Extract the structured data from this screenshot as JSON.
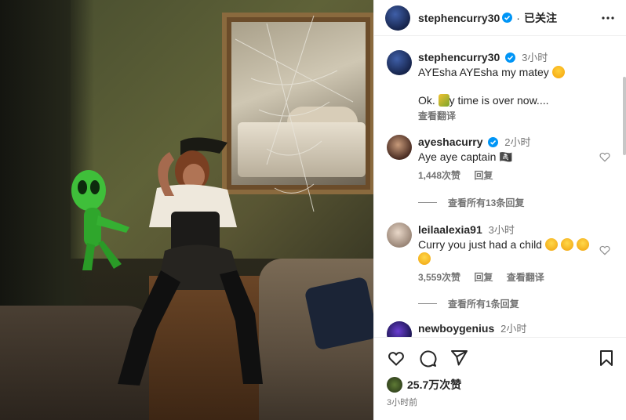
{
  "header": {
    "username": "stephencurry30",
    "follow_label": "已关注",
    "separator": "·"
  },
  "caption": {
    "username": "stephencurry30",
    "time": "3小时",
    "line1": "AYEsha AYEsha my matey",
    "line2": "Ok.",
    "line2_rest": "y time is over now....",
    "translate": "查看翻译"
  },
  "comments": [
    {
      "username": "ayeshacurry",
      "time": "2小时",
      "text": "Aye aye captain",
      "text_tail": "🏴‍☠️",
      "likes": "1,448次赞",
      "reply": "回复",
      "view_replies": "查看所有13条回复"
    },
    {
      "username": "leilaalexia91",
      "time": "3小时",
      "text": "Curry you just had a child",
      "likes": "3,559次赞",
      "reply": "回复",
      "translate": "查看翻译",
      "view_replies": "查看所有1条回复"
    },
    {
      "username": "newboygenius",
      "time": "2小时"
    }
  ],
  "footer": {
    "likes": "25.7万次赞",
    "time_ago": "3小时前"
  },
  "colors": {
    "verified": "#0095f6",
    "text": "#262626",
    "muted": "#737373"
  }
}
